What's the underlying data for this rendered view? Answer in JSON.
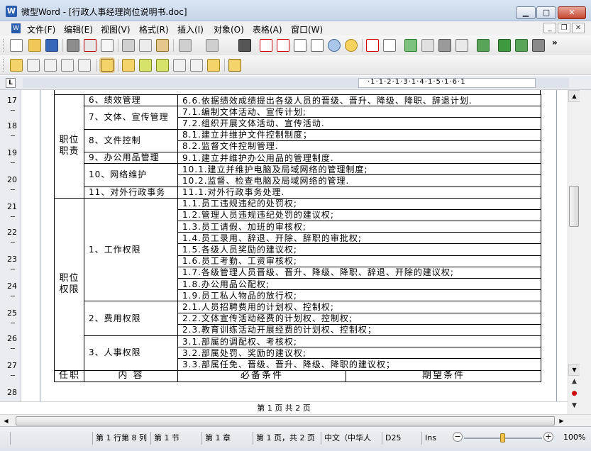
{
  "window": {
    "title": "微型Word - [行政人事经理岗位说明书.doc]",
    "app_icon": "W",
    "minimize": "▁",
    "maximize": "□",
    "close": "✕"
  },
  "menu": {
    "items": [
      "文件(F)",
      "编辑(E)",
      "视图(V)",
      "格式(R)",
      "插入(I)",
      "对象(O)",
      "表格(A)",
      "窗口(W)"
    ],
    "mdi_minimize": "_",
    "mdi_restore": "❐",
    "mdi_close": "✕"
  },
  "toolbar": {
    "more": "»"
  },
  "ruler": {
    "corner": "L",
    "numbers": "·1·1·2·1·3·1·4·1·5·1·6·1"
  },
  "vruler": {
    "lines": [
      "17",
      "18",
      "19",
      "20",
      "21",
      "22",
      "23",
      "24",
      "25",
      "26",
      "27",
      "28"
    ]
  },
  "table": {
    "duties_category": "职位\n职责",
    "duties": [
      {
        "sub": "6、绩效管理",
        "items": [
          "6.6.依据绩效成绩提出各级人员的晋级、晋升、降级、降职、辞退计划."
        ]
      },
      {
        "sub": "7、文体、宣传管理",
        "items": [
          "7.1.编制文体活动、宣传计划;",
          "7.2.组织开展文体活动、宣传活动."
        ]
      },
      {
        "sub": "8、文件控制",
        "items": [
          "8.1.建立并维护文件控制制度；",
          "8.2.监督文件控制管理."
        ]
      },
      {
        "sub": "9、办公用品管理",
        "items": [
          "9.1.建立并维护办公用品的管理制度."
        ]
      },
      {
        "sub": "10、网络维护",
        "items": [
          "10.1.建立并维护电脑及局域网络的管理制度;",
          "10.2.监督、检查电脑及局域网络的管理."
        ]
      },
      {
        "sub": "11、对外行政事务",
        "items": [
          "11.1.对外行政事务处理."
        ]
      }
    ],
    "authority_category": "职位\n权限",
    "authority": [
      {
        "sub": "1、工作权限",
        "items": [
          "1.1.员工违规违纪的处罚权;",
          "1.2.管理人员违规违纪处罚的建议权;",
          "1.3.员工请假、加班的审核权;",
          "1.4.员工录用、辞退、开除、辞职的审批权;",
          "1.5.各级人员奖励的建议权;",
          "1.6.员工考勤、工资审核权;",
          "1.7.各级管理人员晋级、晋升、降级、降职、辞退、开除的建议权;",
          "1.8.办公用品公配权;",
          "1.9.员工私人物品的放行权;"
        ]
      },
      {
        "sub": "2、费用权限",
        "items": [
          "2.1.人员招聘费用的计划权、控制权;",
          "2.2.文体宣传活动经费的计划权、控制权;",
          "2.3.教育训练活动开展经费的计划权、控制权；"
        ]
      },
      {
        "sub": "3、人事权限",
        "items": [
          "3.1.部属的调配权、考核权;",
          "3.2.部属处罚、奖励的建议权;",
          "3.3.部属任免、晋级、晋升、降级、降职的建议权；"
        ]
      }
    ],
    "footer_row": [
      "任职",
      "内  容",
      "必备条件",
      "期望条件"
    ]
  },
  "page_indicator": "第 1 页 共 2 页",
  "status": {
    "line_col": "第 1 行第 8 列",
    "section": "第 1 节",
    "chapter": "第 1 章",
    "page": "第 1 页，共 2 页",
    "language": "中文（中华人",
    "code": "D25",
    "mode": "Ins",
    "zoom": "100%",
    "zoom_minus": "−",
    "zoom_plus": "+"
  },
  "colors": {
    "titlebar": "#c5d5e8",
    "close_button": "#c74832",
    "zoom_knob": "#f6c24a"
  },
  "icons": [
    "new-doc-icon",
    "open-folder-icon",
    "save-icon",
    "print-icon",
    "print-preview-icon",
    "pdf-icon",
    "cut-icon",
    "copy-icon",
    "paste-icon",
    "undo-icon",
    "redo-icon",
    "find-icon",
    "view-icon",
    "zoom-icon",
    "font-color-icon",
    "spell-check-icon",
    "paragraph-icon"
  ]
}
